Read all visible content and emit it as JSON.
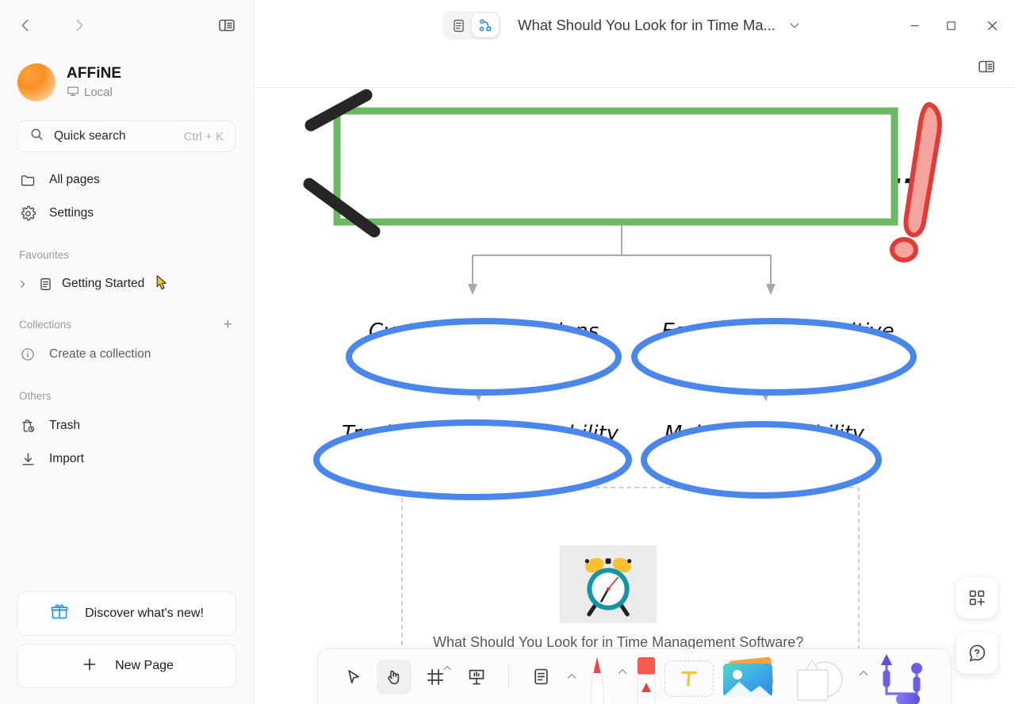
{
  "sidebar": {
    "nav": {
      "back": "back-arrow",
      "forward": "forward-arrow",
      "toggle": "sidebar-toggle"
    },
    "workspace": {
      "name": "AFFiNE",
      "status": "Local"
    },
    "search": {
      "label": "Quick search",
      "shortcut": "Ctrl + K"
    },
    "items": [
      {
        "label": "All pages",
        "icon": "folder-icon"
      },
      {
        "label": "Settings",
        "icon": "gear-icon"
      }
    ],
    "favourites": {
      "title": "Favourites",
      "items": [
        {
          "label": "Getting Started",
          "icon": "doc-icon"
        }
      ]
    },
    "collections": {
      "title": "Collections",
      "add": "+",
      "items": [
        {
          "label": "Create a collection",
          "icon": "info-icon"
        }
      ]
    },
    "others": {
      "title": "Others",
      "items": [
        {
          "label": "Trash",
          "icon": "trash-icon"
        },
        {
          "label": "Import",
          "icon": "download-icon"
        }
      ]
    },
    "bottom": [
      {
        "label": "Discover what's new!",
        "icon": "gift-icon"
      },
      {
        "label": "New Page",
        "icon": "plus-icon"
      }
    ]
  },
  "header": {
    "modes": [
      {
        "name": "page-mode",
        "icon": "page-icon",
        "active": false
      },
      {
        "name": "edgeless-mode",
        "icon": "edgeless-icon",
        "active": true
      }
    ],
    "doc_title": "What Should You Look for in Time Ma...",
    "dropdown": "chevron-down-icon",
    "window": {
      "minimize": "minimize-icon",
      "maximize": "maximize-icon",
      "close": "close-icon"
    },
    "right_panel_toggle": "right-sidebar-toggle"
  },
  "canvas": {
    "title_card": {
      "text": "Time Management Software Include...",
      "border_color": "#6db865"
    },
    "exclamation": {
      "fill": "#f28b82",
      "stroke": "#e23b35"
    },
    "check_stroke_color": "#262626",
    "nodes": [
      {
        "id": "n1",
        "text": "Customization options",
        "color": "#4a87ec"
      },
      {
        "id": "n2",
        "text": "Easy to use & intuitive",
        "color": "#4a87ec"
      },
      {
        "id": "n3",
        "text": "Track and analytical ability",
        "color": "#4a87ec"
      },
      {
        "id": "n4",
        "text": "Mobile accessibility",
        "color": "#4a87ec"
      }
    ],
    "connector_color": "#a9a9a9",
    "note": {
      "caption": "What Should You Look for in Time Management Software?",
      "image": "alarm-clock-image"
    }
  },
  "toolbar": {
    "tools": [
      {
        "name": "select-tool",
        "icon": "cursor-arrow-icon",
        "active": false,
        "caret": false
      },
      {
        "name": "hand-tool",
        "icon": "hand-icon",
        "active": true,
        "caret": false
      },
      {
        "name": "frame-tool",
        "icon": "frame-icon",
        "active": false,
        "caret": true
      },
      {
        "name": "present-tool",
        "icon": "present-icon",
        "active": false,
        "caret": false
      },
      {
        "name": "note-tool",
        "icon": "note-icon",
        "active": false,
        "caret": true
      }
    ],
    "media": [
      {
        "name": "pen-tool",
        "icon": "pen-icon",
        "caret": true
      },
      {
        "name": "eraser-tool",
        "icon": "eraser-icon",
        "caret": false
      },
      {
        "name": "text-tool",
        "icon": "text-T-icon",
        "caret": false
      },
      {
        "name": "image-tool",
        "icon": "image-icon",
        "caret": false
      },
      {
        "name": "shape-tool",
        "icon": "shapes-icon",
        "caret": true
      },
      {
        "name": "connector-tool",
        "icon": "connector-icon",
        "caret": false
      }
    ]
  },
  "floating": [
    {
      "name": "template-button",
      "icon": "add-template-icon"
    },
    {
      "name": "help-button",
      "icon": "question-bubble-icon"
    }
  ]
}
